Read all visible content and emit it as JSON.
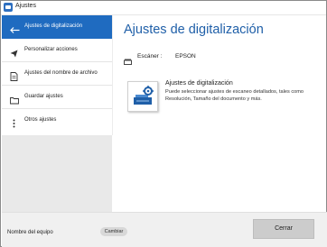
{
  "window": {
    "title": "Ajustes"
  },
  "sidebar": {
    "items": [
      {
        "label": "Ajustes de digitalización",
        "icon": "back-arrow-icon",
        "active": true
      },
      {
        "label": "Personalizar acciones",
        "icon": "paper-plane-icon",
        "active": false
      },
      {
        "label": "Ajustes del nombre de archivo",
        "icon": "document-icon",
        "active": false
      },
      {
        "label": "Guardar ajustes",
        "icon": "folder-icon",
        "active": false
      },
      {
        "label": "Otros ajustes",
        "icon": "more-vertical-icon",
        "active": false
      }
    ]
  },
  "main": {
    "heading": "Ajustes de digitalización",
    "scanner_label": "Escáner :",
    "scanner_value": "EPSON",
    "card": {
      "title": "Ajustes de digitalización",
      "description": "Puede seleccionar ajustes de escaneo detallados, tales como Resolución, Tamaño del documento y más.",
      "icon": "scan-settings-icon"
    }
  },
  "footer": {
    "device_label": "Nombre del equipo",
    "change_label": "Cambiar",
    "close_label": "Cerrar"
  },
  "colors": {
    "accent": "#1f6bc0",
    "heading": "#1f5fa8",
    "sidebar_bg": "#e9e9e9"
  }
}
